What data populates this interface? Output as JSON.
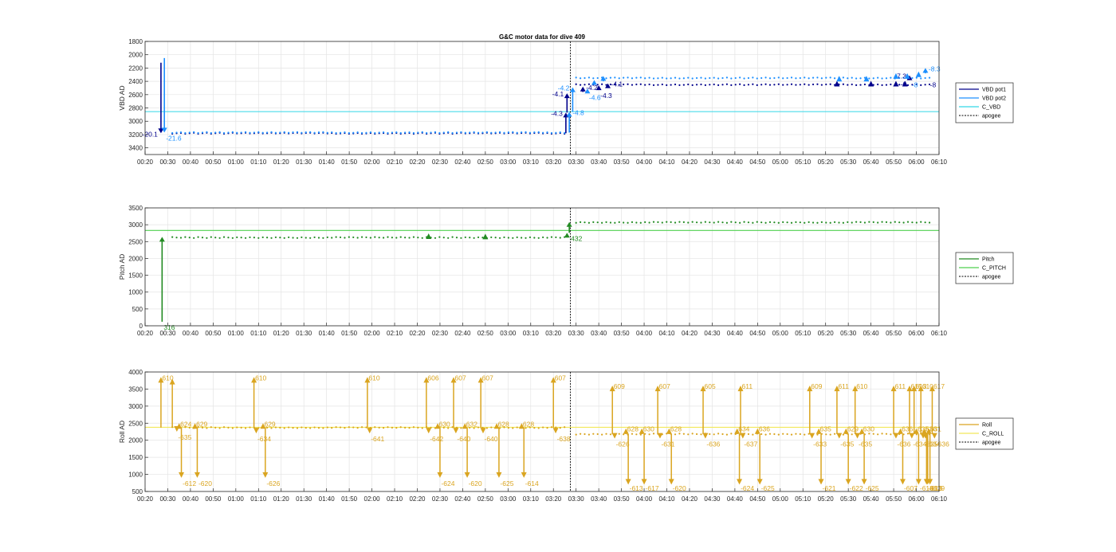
{
  "title": "G&C motor data for dive 409",
  "colors": {
    "vbd_pot1": "#00008b",
    "vbd_pot2": "#1e90ff",
    "c_vbd": "#33d6e8",
    "pitch": "#228b22",
    "c_pitch": "#4fd14f",
    "roll": "#daa520",
    "c_roll": "#f2e85a",
    "apogee": "#000000",
    "grid": "#e4e4e4",
    "axis": "#262626"
  },
  "x_ticks": [
    "00:20",
    "00:30",
    "00:40",
    "00:50",
    "01:00",
    "01:10",
    "01:20",
    "01:30",
    "01:40",
    "01:50",
    "02:00",
    "02:10",
    "02:20",
    "02:30",
    "02:40",
    "02:50",
    "03:00",
    "03:10",
    "03:20",
    "03:30",
    "03:40",
    "03:50",
    "04:00",
    "04:10",
    "04:20",
    "04:30",
    "04:40",
    "04:50",
    "05:00",
    "05:10",
    "05:20",
    "05:30",
    "05:40",
    "05:50",
    "06:00",
    "06:10"
  ],
  "chart_data": [
    {
      "type": "scatter",
      "title": "G&C motor data for dive 409",
      "ylabel": "VBD AD",
      "xlabel": "",
      "x_unit": "minutes",
      "xlim": [
        20,
        370
      ],
      "ylim": [
        1800,
        3500
      ],
      "y_reversed": true,
      "y_ticks": [
        1800,
        2000,
        2200,
        2400,
        2600,
        2800,
        3000,
        3200,
        3400
      ],
      "grid": true,
      "legend": {
        "position": "right",
        "entries": [
          "VBD pot1",
          "VBD pot2",
          "C_VBD",
          "apogee"
        ]
      },
      "apogee_x": 207.5,
      "hlines": [
        {
          "name": "C_VBD",
          "y": 2855,
          "color_key": "c_vbd"
        }
      ],
      "baselines": [
        {
          "series": "VBD pot1",
          "segments": [
            {
              "x0": 32,
              "x1": 206,
              "y": 3180
            },
            {
              "x0": 210,
              "x1": 366,
              "y": 2450
            }
          ]
        },
        {
          "series": "VBD pot2",
          "segments": [
            {
              "x0": 32,
              "x1": 206,
              "y": 3170
            },
            {
              "x0": 210,
              "x1": 366,
              "y": 2350
            }
          ]
        }
      ],
      "arrows": [
        {
          "series": "VBD pot1",
          "x": 27,
          "y0": 2120,
          "y1": 3180,
          "label": "-20.1",
          "label_side": "left"
        },
        {
          "series": "VBD pot2",
          "x": 28.5,
          "y0": 2050,
          "y1": 3170,
          "label": "-21.6",
          "label_side": "below"
        },
        {
          "series": "VBD pot1",
          "x": 205.5,
          "y0": 3180,
          "y1": 2870,
          "label": "-4.3",
          "label_side": "left"
        },
        {
          "series": "VBD pot2",
          "x": 207,
          "y0": 3170,
          "y1": 2860,
          "label": "-4.8",
          "label_side": "right"
        },
        {
          "series": "VBD pot1",
          "x": 206,
          "y0": 2870,
          "y1": 2580,
          "label": "-4.1",
          "label_side": "left"
        },
        {
          "series": "VBD pot2",
          "x": 208.5,
          "y0": 2860,
          "y1": 2490,
          "label": "-4.2",
          "label_side": "left"
        },
        {
          "series": "VBD pot1",
          "x": 213,
          "y0": 2560,
          "y1": 2480,
          "label": "-4.2",
          "label_side": "right"
        },
        {
          "series": "VBD pot2",
          "x": 215,
          "y0": 2560,
          "y1": 2510,
          "label": "-4.6",
          "label_side": "below"
        },
        {
          "series": "VBD pot2",
          "x": 218,
          "y0": 2440,
          "y1": 2380,
          "label": "",
          "label_side": "right"
        },
        {
          "series": "VBD pot1",
          "x": 220,
          "y0": 2530,
          "y1": 2460,
          "label": "-4.3",
          "label_side": "below"
        },
        {
          "series": "VBD pot2",
          "x": 222,
          "y0": 2400,
          "y1": 2320,
          "label": "",
          "label_side": "right"
        },
        {
          "series": "VBD pot1",
          "x": 224,
          "y0": 2470,
          "y1": 2430,
          "label": "-4.1",
          "label_side": "right"
        },
        {
          "series": "VBD pot1",
          "x": 357,
          "y0": 2380,
          "y1": 2310,
          "label": "-7.3",
          "label_side": "left"
        },
        {
          "series": "VBD pot2",
          "x": 364,
          "y0": 2280,
          "y1": 2200,
          "label": "-8.3",
          "label_side": "right"
        }
      ],
      "markers": [
        {
          "series": "VBD pot1",
          "x": 325,
          "y": 2440
        },
        {
          "series": "VBD pot1",
          "x": 340,
          "y": 2440
        },
        {
          "series": "VBD pot1",
          "x": 351,
          "y": 2440
        },
        {
          "series": "VBD pot1",
          "x": 355,
          "y": 2440
        },
        {
          "series": "VBD pot2",
          "x": 326,
          "y": 2365
        },
        {
          "series": "VBD pot2",
          "x": 338,
          "y": 2365
        },
        {
          "series": "VBD pot2",
          "x": 351,
          "y": 2325
        },
        {
          "series": "VBD pot2",
          "x": 356,
          "y": 2325
        },
        {
          "series": "VBD pot2",
          "x": 361,
          "y": 2300
        }
      ],
      "extra_labels": [
        {
          "series": "VBD pot1",
          "x": 353,
          "y": 2430,
          "text": "-6"
        },
        {
          "series": "VBD pot2",
          "x": 358,
          "y": 2440,
          "text": "-8"
        },
        {
          "series": "VBD pot1",
          "x": 366,
          "y": 2440,
          "text": "-8"
        }
      ]
    },
    {
      "type": "scatter",
      "ylabel": "Pitch AD",
      "xlabel": "",
      "x_unit": "minutes",
      "xlim": [
        20,
        370
      ],
      "ylim": [
        0,
        3500
      ],
      "y_ticks": [
        0,
        500,
        1000,
        1500,
        2000,
        2500,
        3000,
        3500
      ],
      "grid": true,
      "legend": {
        "position": "right",
        "entries": [
          "Pitch",
          "C_PITCH",
          "apogee"
        ]
      },
      "apogee_x": 207.5,
      "hlines": [
        {
          "name": "C_PITCH",
          "y": 2830,
          "color_key": "c_pitch"
        }
      ],
      "baselines": [
        {
          "series": "Pitch",
          "segments": [
            {
              "x0": 32,
              "x1": 205,
              "y": 2620
            },
            {
              "x0": 210,
              "x1": 366,
              "y": 3070
            }
          ]
        }
      ],
      "arrows": [
        {
          "series": "Pitch",
          "x": 27.5,
          "y0": 120,
          "y1": 2640,
          "label": "316",
          "label_side": "below"
        },
        {
          "series": "Pitch",
          "x": 206,
          "y0": 2620,
          "y1": 2760,
          "label": "",
          "label_side": "right"
        },
        {
          "series": "Pitch",
          "x": 207,
          "y0": 2760,
          "y1": 3080,
          "label": "432",
          "label_side": "below"
        }
      ],
      "markers": [
        {
          "series": "Pitch",
          "x": 145,
          "y": 2650
        },
        {
          "series": "Pitch",
          "x": 170,
          "y": 2640
        }
      ],
      "extra_labels": []
    },
    {
      "type": "scatter",
      "ylabel": "Roll AD",
      "xlabel": "",
      "x_unit": "minutes",
      "xlim": [
        20,
        370
      ],
      "ylim": [
        500,
        4000
      ],
      "y_ticks": [
        500,
        1000,
        1500,
        2000,
        2500,
        3000,
        3500,
        4000
      ],
      "grid": true,
      "legend": {
        "position": "right",
        "entries": [
          "Roll",
          "C_ROLL",
          "apogee"
        ]
      },
      "apogee_x": 207.5,
      "hlines": [
        {
          "name": "C_ROLL",
          "y": 2380,
          "color_key": "c_roll"
        }
      ],
      "baselines": [
        {
          "series": "Roll",
          "segments": [
            {
              "x0": 32,
              "x1": 205,
              "y": 2370
            },
            {
              "x0": 210,
              "x1": 366,
              "y": 2180
            }
          ]
        }
      ],
      "spikes": [
        {
          "x": 27,
          "base": 2370,
          "tip": 3850,
          "label": "610"
        },
        {
          "x": 32,
          "base": 2370,
          "tip": 3800,
          "label": ""
        },
        {
          "x": 34,
          "base": 2370,
          "tip": 2250,
          "label": "-635"
        },
        {
          "x": 35,
          "base": 2370,
          "tip": 2500,
          "label": "624"
        },
        {
          "x": 36,
          "base": 2370,
          "tip": 900,
          "label": "-612"
        },
        {
          "x": 42,
          "base": 2370,
          "tip": 2500,
          "label": "629"
        },
        {
          "x": 43,
          "base": 2370,
          "tip": 900,
          "label": "-620"
        },
        {
          "x": 68,
          "base": 2370,
          "tip": 3850,
          "label": "610"
        },
        {
          "x": 69,
          "base": 2370,
          "tip": 2200,
          "label": "-634"
        },
        {
          "x": 72,
          "base": 2370,
          "tip": 2500,
          "label": "629"
        },
        {
          "x": 73,
          "base": 2370,
          "tip": 900,
          "label": "-626"
        },
        {
          "x": 118,
          "base": 2370,
          "tip": 3850,
          "label": "610"
        },
        {
          "x": 119,
          "base": 2370,
          "tip": 2200,
          "label": "-641"
        },
        {
          "x": 144,
          "base": 2370,
          "tip": 3850,
          "label": "606"
        },
        {
          "x": 145,
          "base": 2370,
          "tip": 2200,
          "label": "-642"
        },
        {
          "x": 149,
          "base": 2370,
          "tip": 2500,
          "label": "630"
        },
        {
          "x": 150,
          "base": 2370,
          "tip": 900,
          "label": "-624"
        },
        {
          "x": 156,
          "base": 2370,
          "tip": 3850,
          "label": "607"
        },
        {
          "x": 157,
          "base": 2370,
          "tip": 2200,
          "label": "-640"
        },
        {
          "x": 161,
          "base": 2370,
          "tip": 2500,
          "label": "632"
        },
        {
          "x": 162,
          "base": 2370,
          "tip": 900,
          "label": "-620"
        },
        {
          "x": 168,
          "base": 2370,
          "tip": 3850,
          "label": "607"
        },
        {
          "x": 169,
          "base": 2370,
          "tip": 2200,
          "label": "-640"
        },
        {
          "x": 175,
          "base": 2370,
          "tip": 2500,
          "label": "628"
        },
        {
          "x": 176,
          "base": 2370,
          "tip": 900,
          "label": "-625"
        },
        {
          "x": 186,
          "base": 2370,
          "tip": 2500,
          "label": "628"
        },
        {
          "x": 187,
          "base": 2370,
          "tip": 900,
          "label": "-614"
        },
        {
          "x": 200,
          "base": 2370,
          "tip": 3850,
          "label": "607"
        },
        {
          "x": 201,
          "base": 2370,
          "tip": 2200,
          "label": "-638"
        },
        {
          "x": 226,
          "base": 2180,
          "tip": 3600,
          "label": "609"
        },
        {
          "x": 227,
          "base": 2180,
          "tip": 2050,
          "label": "-626"
        },
        {
          "x": 232,
          "base": 2180,
          "tip": 2350,
          "label": "628"
        },
        {
          "x": 233,
          "base": 2180,
          "tip": 700,
          "label": "-613"
        },
        {
          "x": 239,
          "base": 2180,
          "tip": 2350,
          "label": "630"
        },
        {
          "x": 240,
          "base": 2180,
          "tip": 700,
          "label": "-617"
        },
        {
          "x": 246,
          "base": 2180,
          "tip": 3600,
          "label": "607"
        },
        {
          "x": 247,
          "base": 2180,
          "tip": 2050,
          "label": "-631"
        },
        {
          "x": 251,
          "base": 2180,
          "tip": 2350,
          "label": "628"
        },
        {
          "x": 252,
          "base": 2180,
          "tip": 700,
          "label": "-620"
        },
        {
          "x": 266,
          "base": 2180,
          "tip": 3600,
          "label": "605"
        },
        {
          "x": 267,
          "base": 2180,
          "tip": 2050,
          "label": "-636"
        },
        {
          "x": 281,
          "base": 2180,
          "tip": 2350,
          "label": "634"
        },
        {
          "x": 282,
          "base": 2180,
          "tip": 700,
          "label": "-624"
        },
        {
          "x": 282.5,
          "base": 2180,
          "tip": 3600,
          "label": "611"
        },
        {
          "x": 283.5,
          "base": 2180,
          "tip": 2050,
          "label": "-637"
        },
        {
          "x": 290,
          "base": 2180,
          "tip": 2350,
          "label": "636"
        },
        {
          "x": 291,
          "base": 2180,
          "tip": 700,
          "label": "-625"
        },
        {
          "x": 313,
          "base": 2180,
          "tip": 3600,
          "label": "609"
        },
        {
          "x": 314,
          "base": 2180,
          "tip": 2050,
          "label": "-633"
        },
        {
          "x": 317,
          "base": 2180,
          "tip": 2350,
          "label": "635"
        },
        {
          "x": 318,
          "base": 2180,
          "tip": 700,
          "label": "-621"
        },
        {
          "x": 325,
          "base": 2180,
          "tip": 3600,
          "label": "611"
        },
        {
          "x": 326,
          "base": 2180,
          "tip": 2050,
          "label": "-635"
        },
        {
          "x": 329,
          "base": 2180,
          "tip": 2350,
          "label": "629"
        },
        {
          "x": 330,
          "base": 2180,
          "tip": 700,
          "label": "-622"
        },
        {
          "x": 333,
          "base": 2180,
          "tip": 3600,
          "label": "610"
        },
        {
          "x": 334,
          "base": 2180,
          "tip": 2050,
          "label": "-635"
        },
        {
          "x": 336,
          "base": 2180,
          "tip": 2350,
          "label": "630"
        },
        {
          "x": 337,
          "base": 2180,
          "tip": 700,
          "label": "-625"
        },
        {
          "x": 350,
          "base": 2180,
          "tip": 3600,
          "label": "611"
        },
        {
          "x": 351,
          "base": 2180,
          "tip": 2050,
          "label": "-636"
        },
        {
          "x": 353,
          "base": 2180,
          "tip": 2350,
          "label": "636"
        },
        {
          "x": 354,
          "base": 2180,
          "tip": 700,
          "label": "-607"
        },
        {
          "x": 357,
          "base": 2180,
          "tip": 3600,
          "label": "615"
        },
        {
          "x": 358,
          "base": 2180,
          "tip": 2050,
          "label": "-634"
        },
        {
          "x": 359,
          "base": 2180,
          "tip": 3600,
          "label": "613"
        },
        {
          "x": 360,
          "base": 2180,
          "tip": 2350,
          "label": "635"
        },
        {
          "x": 361,
          "base": 2180,
          "tip": 700,
          "label": "-618"
        },
        {
          "x": 362,
          "base": 2180,
          "tip": 3600,
          "label": "610"
        },
        {
          "x": 363,
          "base": 2180,
          "tip": 2050,
          "label": "-635"
        },
        {
          "x": 363.5,
          "base": 2180,
          "tip": 2350,
          "label": "636"
        },
        {
          "x": 364,
          "base": 2180,
          "tip": 2050,
          "label": "-634"
        },
        {
          "x": 364.5,
          "base": 2180,
          "tip": 700,
          "label": "-613"
        },
        {
          "x": 365,
          "base": 2180,
          "tip": 700,
          "label": "-613"
        },
        {
          "x": 365.5,
          "base": 2180,
          "tip": 2350,
          "label": "631"
        },
        {
          "x": 366,
          "base": 2180,
          "tip": 700,
          "label": "-619"
        },
        {
          "x": 367,
          "base": 2180,
          "tip": 3600,
          "label": "617"
        },
        {
          "x": 368,
          "base": 2180,
          "tip": 2050,
          "label": "-636"
        }
      ]
    }
  ]
}
